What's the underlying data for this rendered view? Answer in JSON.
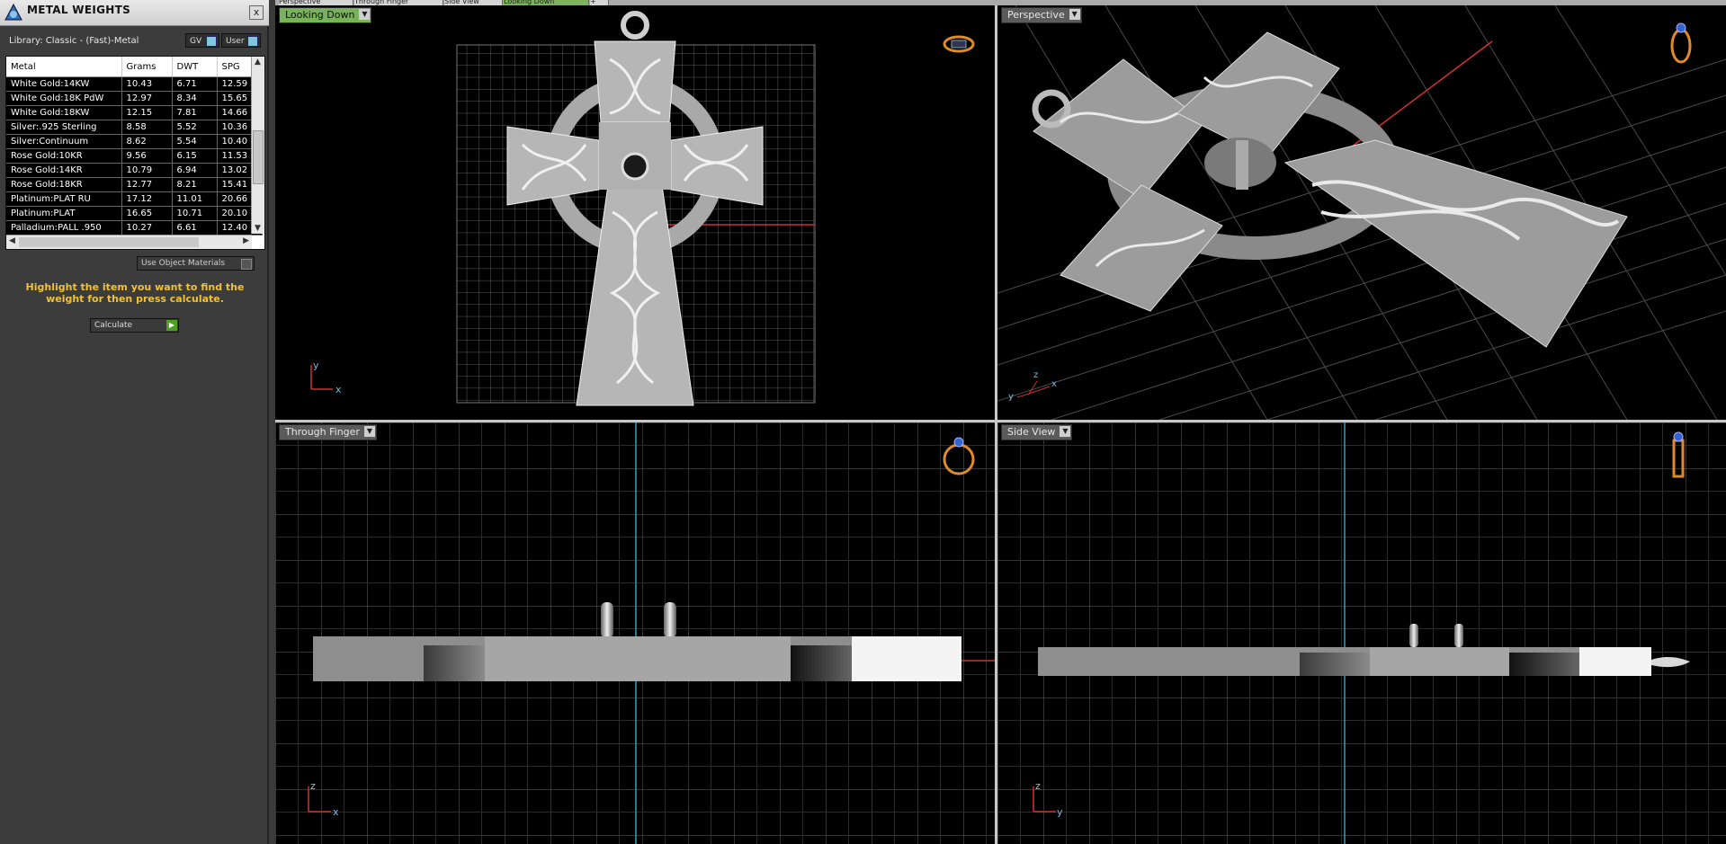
{
  "panel": {
    "title": "METAL WEIGHTS",
    "close": "x",
    "library": "Library: Classic - (Fast)-Metal",
    "gv_label": "GV",
    "user_label": "User",
    "columns": [
      "Metal",
      "Grams",
      "DWT",
      "SPG"
    ],
    "rows": [
      [
        "White Gold:14KW",
        "10.43",
        "6.71",
        "12.59"
      ],
      [
        "White Gold:18K PdW",
        "12.97",
        "8.34",
        "15.65"
      ],
      [
        "White Gold:18KW",
        "12.15",
        "7.81",
        "14.66"
      ],
      [
        "Silver:.925 Sterling",
        "8.58",
        "5.52",
        "10.36"
      ],
      [
        "Silver:Continuum",
        "8.62",
        "5.54",
        "10.40"
      ],
      [
        "Rose Gold:10KR",
        "9.56",
        "6.15",
        "11.53"
      ],
      [
        "Rose Gold:14KR",
        "10.79",
        "6.94",
        "13.02"
      ],
      [
        "Rose Gold:18KR",
        "12.77",
        "8.21",
        "15.41"
      ],
      [
        "Platinum:PLAT RU",
        "17.12",
        "11.01",
        "20.66"
      ],
      [
        "Platinum:PLAT",
        "16.65",
        "10.71",
        "20.10"
      ],
      [
        "Palladium:PALL .950",
        "10.27",
        "6.61",
        "12.40"
      ]
    ],
    "use_object_materials": "Use Object Materials",
    "hint": "Highlight the item you want to find the weight for then press calculate.",
    "calculate": "Calculate"
  },
  "tabs": [
    "Perspective",
    "Through Finger",
    "Side View",
    "Looking Down",
    "+"
  ],
  "viewports": {
    "top_left": {
      "label": "Looking Down",
      "axis_a": "y",
      "axis_b": "x"
    },
    "top_right": {
      "label": "Perspective",
      "axis_a": "z",
      "axis_b": "x",
      "axis_c": "y"
    },
    "bottom_left": {
      "label": "Through Finger",
      "axis_a": "z",
      "axis_b": "x"
    },
    "bottom_right": {
      "label": "Side View",
      "axis_a": "z",
      "axis_b": "y"
    }
  },
  "colors": {
    "accent_green": "#78b25a",
    "hint_yellow": "#f2c233",
    "axis_red": "#d03030",
    "axis_cyan": "#2aa0b8",
    "gizmo_orange": "#e08a2a"
  }
}
